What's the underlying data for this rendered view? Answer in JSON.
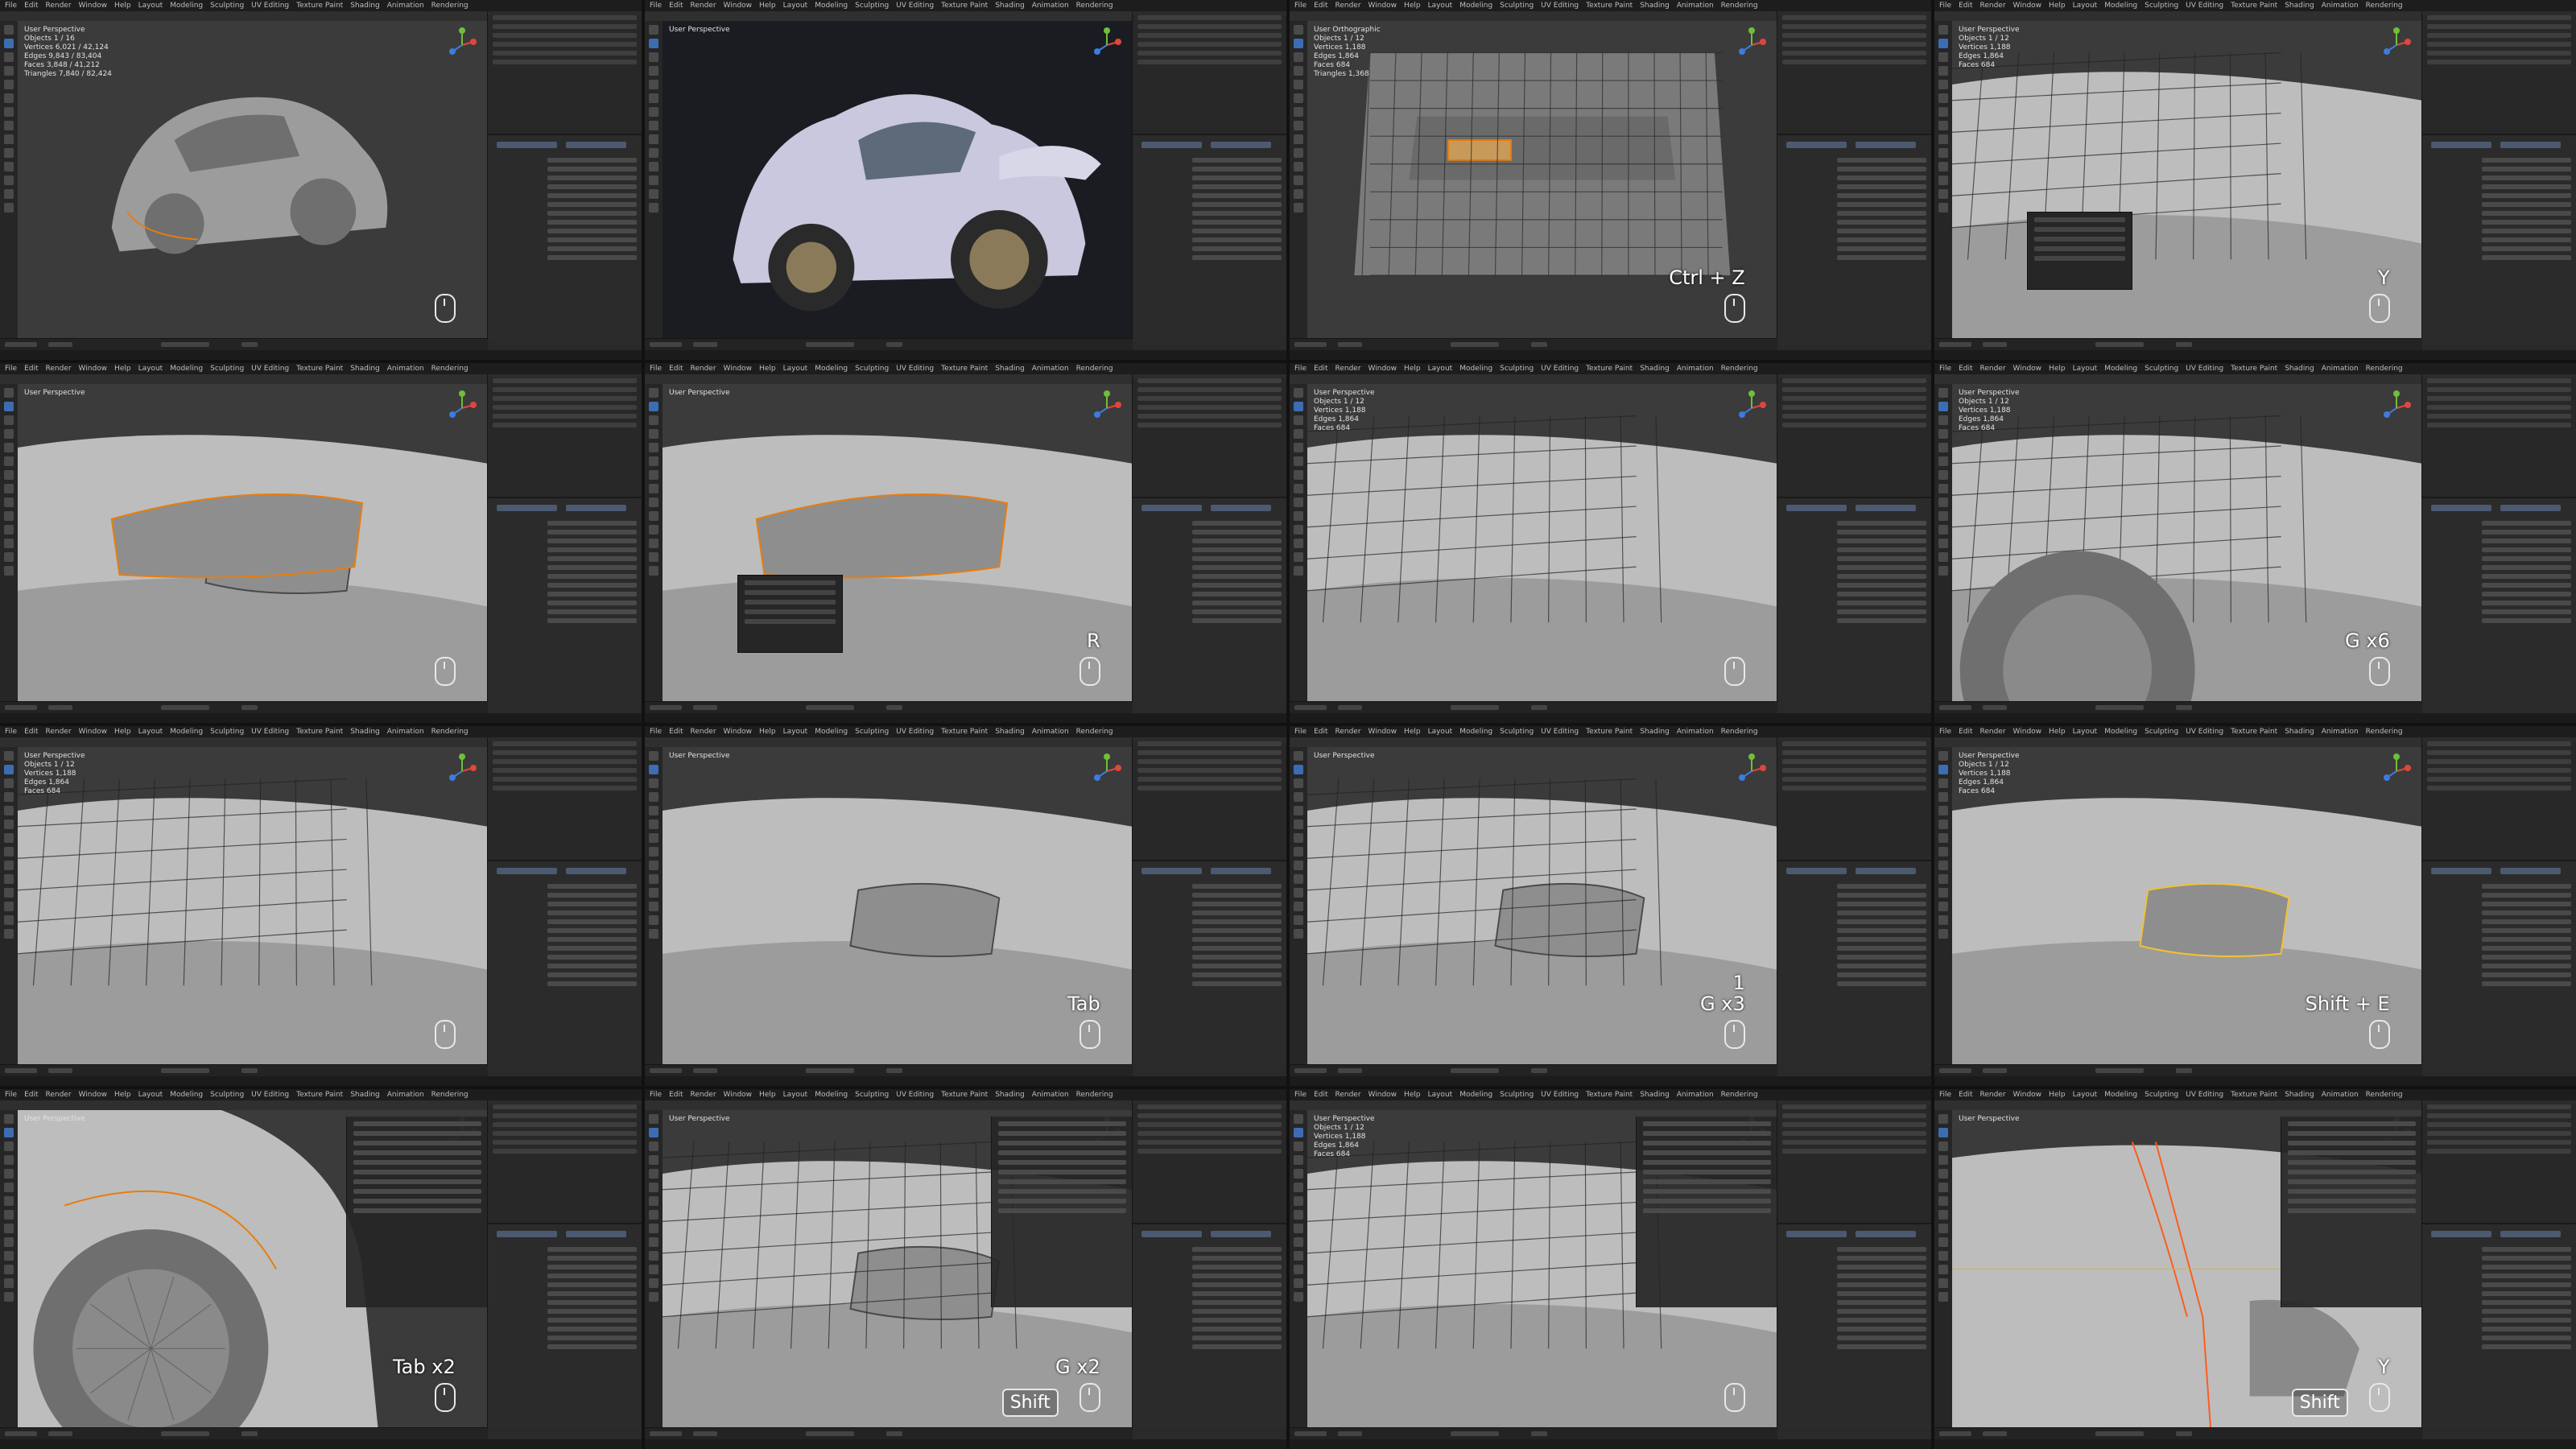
{
  "app": {
    "menu": [
      "File",
      "Edit",
      "Render",
      "Window",
      "Help"
    ],
    "workspaces": [
      "Layout",
      "Modeling",
      "Sculpting",
      "UV Editing",
      "Texture Paint",
      "Shading",
      "Animation",
      "Rendering"
    ],
    "accent": "#3c6db3",
    "highlight": "#e87d0d"
  },
  "tiles": [
    {
      "view": "User Perspective",
      "stats": [
        "Objects 1 / 16",
        "Vertices 6,021 / 42,124",
        "Edges 9,843 / 83,404",
        "Faces 3,848 / 41,212",
        "Triangles 7,840 / 82,424"
      ],
      "keys": [],
      "shift": false,
      "mouse": true,
      "scene": "car-front"
    },
    {
      "view": "User Perspective",
      "stats": [],
      "keys": [],
      "shift": false,
      "mouse": false,
      "scene": "car-render"
    },
    {
      "view": "User Orthographic",
      "stats": [
        "Objects 1 / 12",
        "Vertices 1,188",
        "Edges 1,864",
        "Faces 684",
        "Triangles 1,368"
      ],
      "keys": [
        "Ctrl + Z"
      ],
      "shift": false,
      "mouse": true,
      "scene": "rear-ortho"
    },
    {
      "view": "User Perspective",
      "stats": [
        "Objects 1 / 12",
        "Vertices 1,188",
        "Edges 1,864",
        "Faces 684"
      ],
      "keys": [
        "Y"
      ],
      "shift": false,
      "mouse": true,
      "scene": "rear-top",
      "popup": true
    },
    {
      "view": "User Perspective",
      "stats": [],
      "keys": [],
      "shift": false,
      "mouse": true,
      "scene": "tail-light"
    },
    {
      "view": "User Perspective",
      "stats": [],
      "keys": [
        "R"
      ],
      "shift": false,
      "mouse": true,
      "scene": "rear-edge",
      "popup": true
    },
    {
      "view": "User Perspective",
      "stats": [
        "Objects 1 / 12",
        "Vertices 1,188",
        "Edges 1,864",
        "Faces 684"
      ],
      "keys": [],
      "shift": false,
      "mouse": true,
      "scene": "wing-under"
    },
    {
      "view": "User Perspective",
      "stats": [
        "Objects 1 / 12",
        "Vertices 1,188",
        "Edges 1,864",
        "Faces 684"
      ],
      "keys": [
        "G x6"
      ],
      "shift": false,
      "mouse": true,
      "scene": "wheel-arch"
    },
    {
      "view": "User Perspective",
      "stats": [
        "Objects 1 / 12",
        "Vertices 1,188",
        "Edges 1,864",
        "Faces 684"
      ],
      "keys": [],
      "shift": false,
      "mouse": true,
      "scene": "fender-wire"
    },
    {
      "view": "User Perspective",
      "stats": [],
      "keys": [
        "Tab"
      ],
      "shift": false,
      "mouse": true,
      "scene": "fender-light"
    },
    {
      "view": "User Perspective",
      "stats": [],
      "keys": [
        "1",
        "G x3"
      ],
      "shift": false,
      "mouse": true,
      "scene": "fender-light-wire"
    },
    {
      "view": "User Perspective",
      "stats": [
        "Objects 1 / 12",
        "Vertices 1,188",
        "Edges 1,864",
        "Faces 684"
      ],
      "keys": [
        "Shift + E"
      ],
      "shift": false,
      "mouse": true,
      "scene": "light-select"
    },
    {
      "view": "User Perspective",
      "stats": [],
      "keys": [
        "Tab x2"
      ],
      "shift": false,
      "mouse": true,
      "scene": "rear-wheel",
      "npanel": true
    },
    {
      "view": "User Perspective",
      "stats": [],
      "keys": [
        "G x2"
      ],
      "shift": true,
      "mouse": true,
      "scene": "light-wire2",
      "npanel": true
    },
    {
      "view": "User Perspective",
      "stats": [
        "Objects 1 / 12",
        "Vertices 1,188",
        "Edges 1,864",
        "Faces 684"
      ],
      "keys": [],
      "shift": false,
      "mouse": true,
      "scene": "corner-wire",
      "npanel": true
    },
    {
      "view": "User Perspective",
      "stats": [],
      "keys": [
        "Y"
      ],
      "shift": true,
      "mouse": true,
      "scene": "edge-loop",
      "npanel": true
    }
  ],
  "shift_label": "Shift"
}
